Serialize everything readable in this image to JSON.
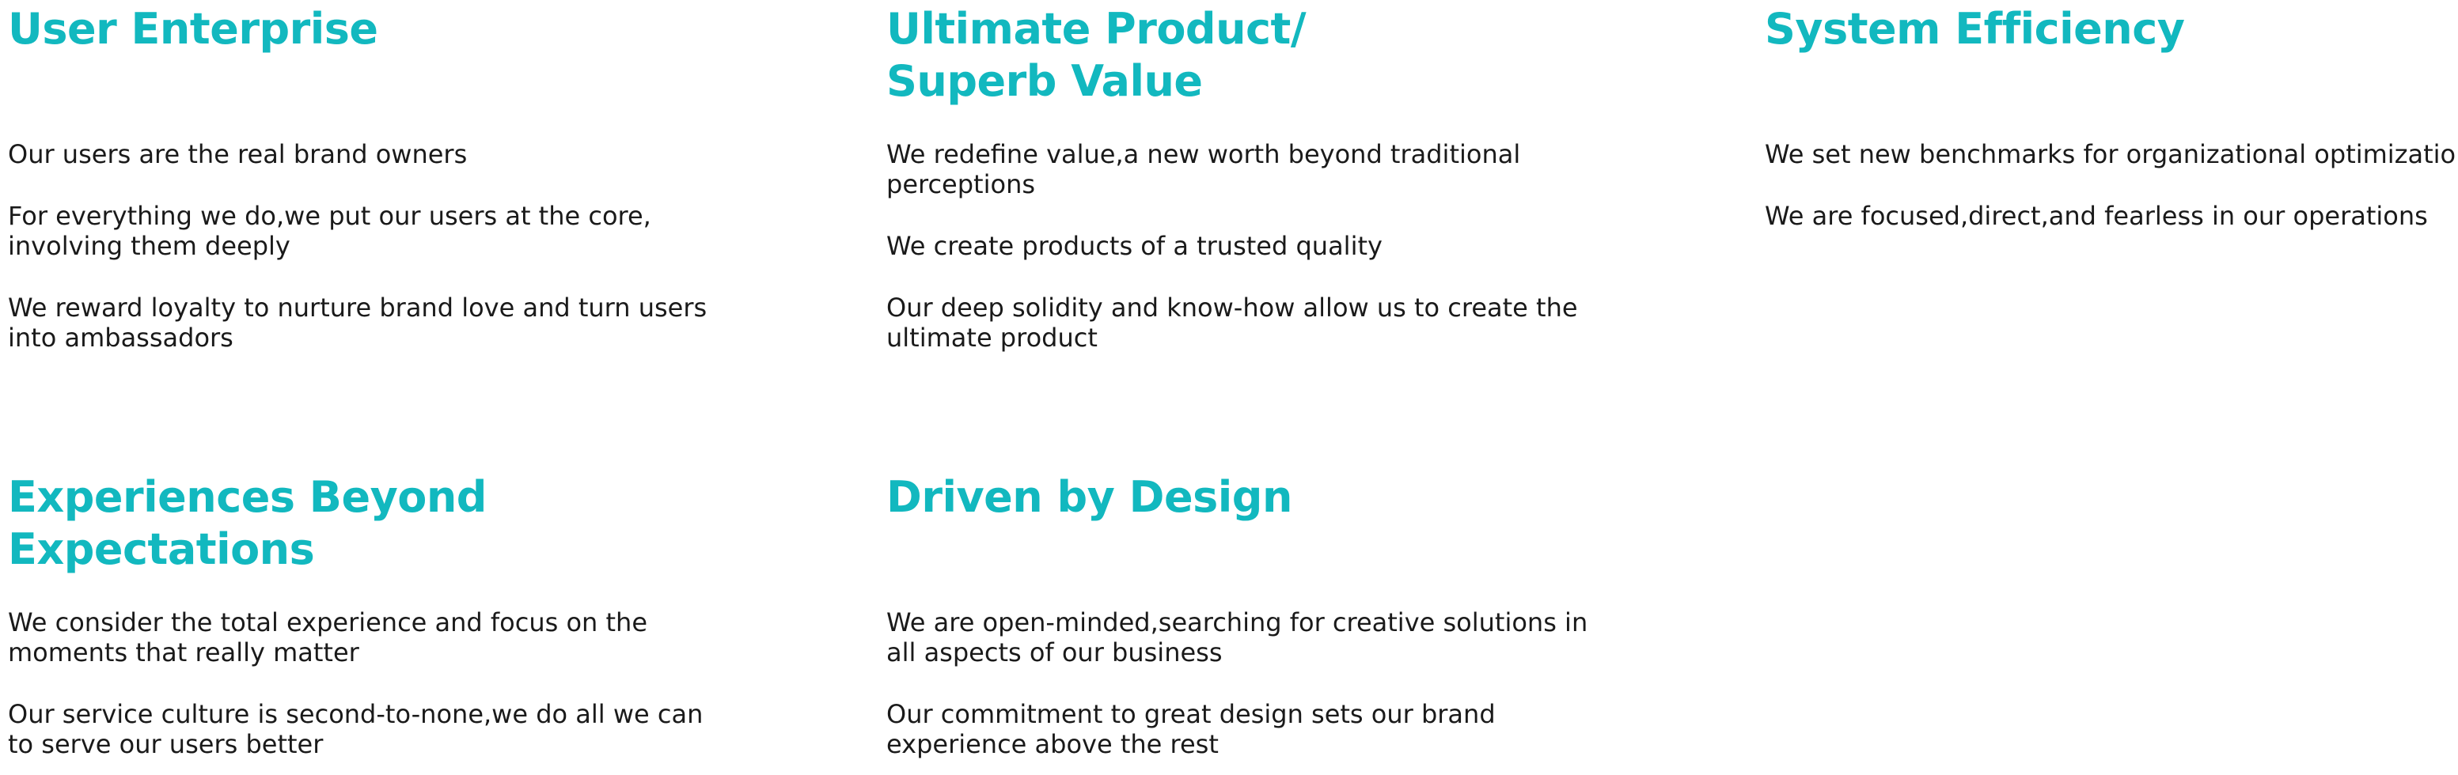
{
  "colors": {
    "heading": "#12b8bf",
    "body_text": "#1a1a1a",
    "background": "#ffffff"
  },
  "sections": [
    {
      "title_lines": [
        "User Enterprise"
      ],
      "items": [
        "Our users are the real brand owners",
        "For everything we do,we put our users at the core, involving them deeply",
        "We reward loyalty to nurture brand love and turn users into ambassadors"
      ]
    },
    {
      "title_lines": [
        "Ultimate Product/",
        "Superb Value"
      ],
      "items": [
        "We redefine value,a new worth beyond traditional perceptions",
        "We create products of a trusted quality",
        "Our deep solidity and know-how allow us to create the ultimate product"
      ]
    },
    {
      "title_lines": [
        "System Efficiency"
      ],
      "items": [
        "We set new benchmarks for organizational optimization",
        "We are focused,direct,and fearless in our operations"
      ]
    },
    {
      "title_lines": [
        "Experiences Beyond",
        "Expectations"
      ],
      "items": [
        "We consider the total experience and focus on the moments that really matter",
        "Our service culture is second-to-none,we do all we can to serve our users better"
      ]
    },
    {
      "title_lines": [
        "Driven by Design"
      ],
      "items": [
        "We are open-minded,searching for creative solutions in all aspects of our business",
        "Our commitment to great design sets our brand experience above the rest"
      ]
    }
  ]
}
